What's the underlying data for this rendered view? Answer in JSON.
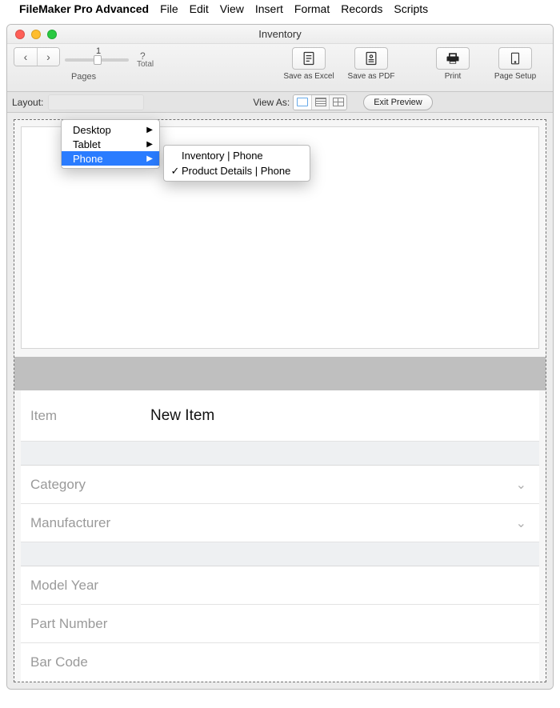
{
  "menubar": {
    "app_name": "FileMaker Pro Advanced",
    "items": [
      "File",
      "Edit",
      "View",
      "Insert",
      "Format",
      "Records",
      "Scripts"
    ]
  },
  "window": {
    "title": "Inventory"
  },
  "toolbar": {
    "page_number": "1",
    "pages_label": "Pages",
    "total_symbol": "?",
    "total_label": "Total",
    "save_excel_label": "Save as Excel",
    "save_pdf_label": "Save as PDF",
    "print_label": "Print",
    "page_setup_label": "Page Setup"
  },
  "layoutbar": {
    "layout_label": "Layout:",
    "viewas_label": "View As:",
    "exit_label": "Exit Preview"
  },
  "layout_menu": {
    "items": [
      {
        "label": "Desktop",
        "has_submenu": true,
        "selected": false
      },
      {
        "label": "Tablet",
        "has_submenu": true,
        "selected": false
      },
      {
        "label": "Phone",
        "has_submenu": true,
        "selected": true
      }
    ]
  },
  "submenu": {
    "items": [
      {
        "label": "Inventory | Phone",
        "checked": false
      },
      {
        "label": "Product Details | Phone",
        "checked": true
      }
    ]
  },
  "form": {
    "item_label": "Item",
    "item_value": "New Item",
    "category_label": "Category",
    "manufacturer_label": "Manufacturer",
    "model_year_label": "Model Year",
    "part_number_label": "Part Number",
    "bar_code_label": "Bar Code"
  }
}
